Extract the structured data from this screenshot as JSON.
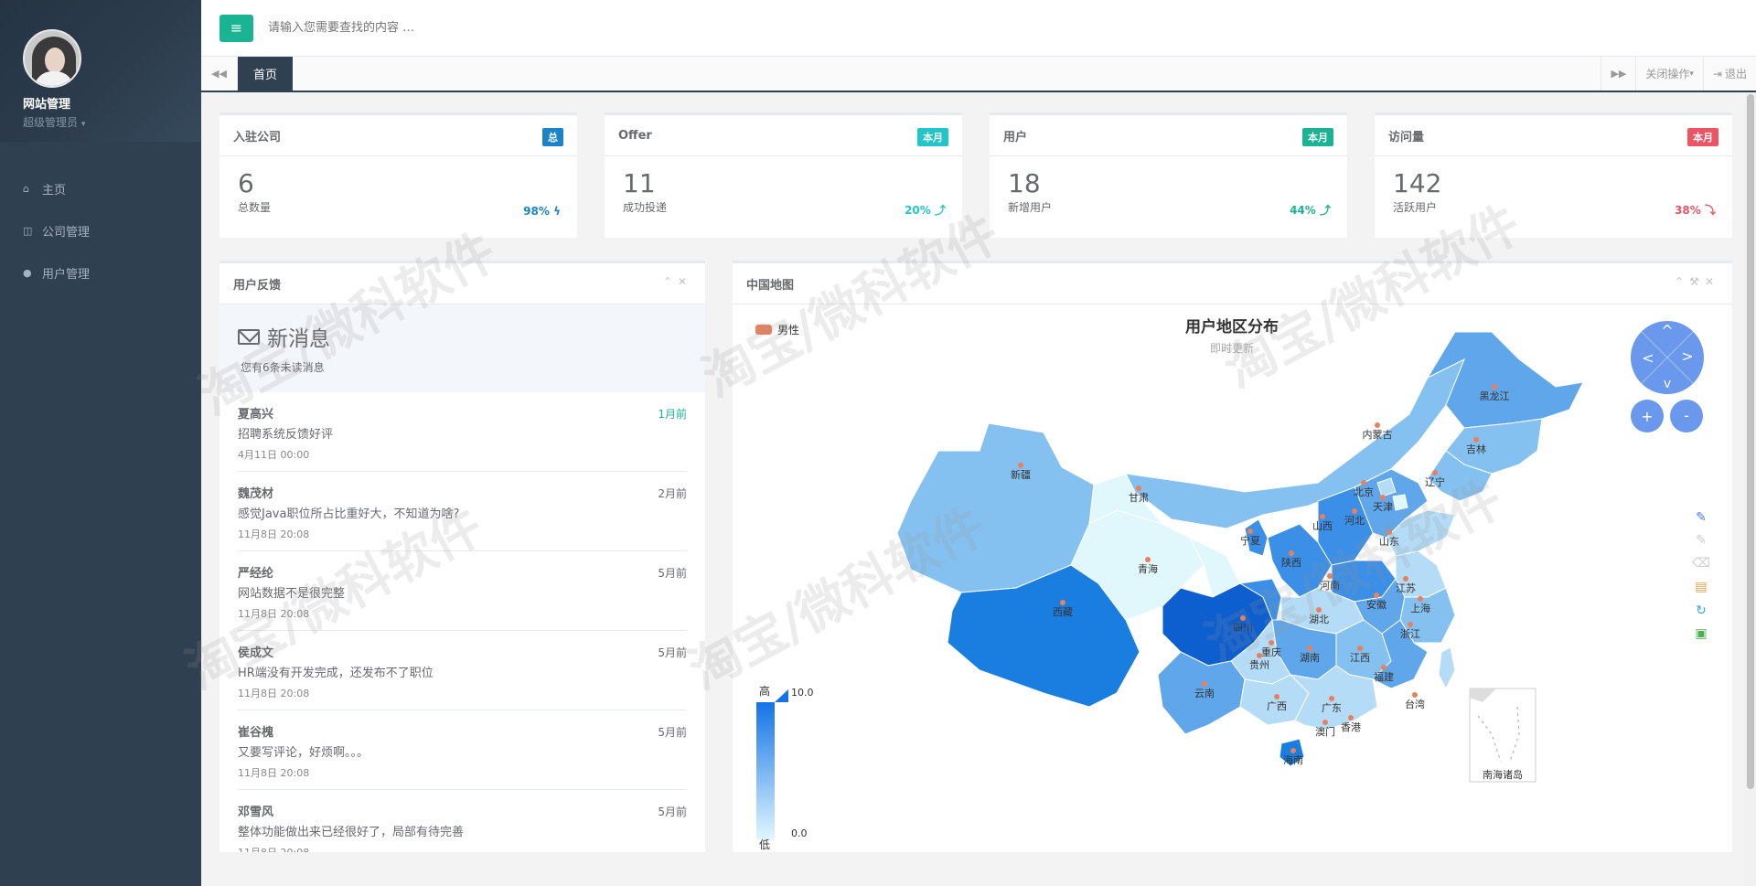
{
  "sidebar": {
    "user_name": "网站管理",
    "user_role": "超级管理员",
    "items": [
      {
        "label": "主页",
        "icon": "home-icon"
      },
      {
        "label": "公司管理",
        "icon": "columns-icon"
      },
      {
        "label": "用户管理",
        "icon": "user-icon"
      }
    ]
  },
  "topbar": {
    "search_placeholder": "请输入您需要查找的内容 …"
  },
  "tabs": {
    "active": "首页",
    "close_ops": "关闭操作",
    "logout": "退出"
  },
  "stats": [
    {
      "title": "入驻公司",
      "badge": "总",
      "badge_color": "#1c84c6",
      "value": "6",
      "label": "总数量",
      "percent": "98%",
      "percent_color": "#1c84c6",
      "trend": "bolt"
    },
    {
      "title": "Offer",
      "badge": "本月",
      "badge_color": "#23c6c8",
      "value": "11",
      "label": "成功投递",
      "percent": "20%",
      "percent_color": "#23c6c8",
      "trend": "up"
    },
    {
      "title": "用户",
      "badge": "本月",
      "badge_color": "#1ab394",
      "value": "18",
      "label": "新增用户",
      "percent": "44%",
      "percent_color": "#1ab394",
      "trend": "up"
    },
    {
      "title": "访问量",
      "badge": "本月",
      "badge_color": "#ed5565",
      "value": "142",
      "label": "活跃用户",
      "percent": "38%",
      "percent_color": "#ed5565",
      "trend": "down"
    }
  ],
  "feedback": {
    "title": "用户反馈",
    "new_title": "新消息",
    "new_sub": "您有6条未读消息",
    "items": [
      {
        "name": "夏高兴",
        "text": "招聘系统反馈好评",
        "date": "4月11日 00:00",
        "time": "1月前",
        "recent": true
      },
      {
        "name": "魏茂材",
        "text": "感觉Java职位所占比重好大，不知道为啥?",
        "date": "11月8日 20:08",
        "time": "2月前",
        "recent": false
      },
      {
        "name": "严经纶",
        "text": "网站数据不是很完整",
        "date": "11月8日 20:08",
        "time": "5月前",
        "recent": false
      },
      {
        "name": "侯成文",
        "text": "HR端没有开发完成，还发布不了职位",
        "date": "11月8日 20:08",
        "time": "5月前",
        "recent": false
      },
      {
        "name": "崔谷槐",
        "text": "又要写评论，好烦啊。。。",
        "date": "11月8日 20:08",
        "time": "5月前",
        "recent": false
      },
      {
        "name": "邓雪风",
        "text": "整体功能做出来已经很好了，局部有待完善",
        "date": "11月8日 20:08",
        "time": "5月前",
        "recent": false
      }
    ]
  },
  "map": {
    "panel_title": "中国地图",
    "title": "用户地区分布",
    "subtitle": "即时更新",
    "legend": "男性",
    "legend_color": "#e8805e",
    "range_high_label": "高",
    "range_low_label": "低",
    "range_max": "10.0",
    "range_min": "0.0",
    "south_sea_label": "南海诸岛",
    "provinces": [
      "黑龙江",
      "吉林",
      "辽宁",
      "内蒙古",
      "新疆",
      "甘肃",
      "宁夏",
      "北京",
      "天津",
      "河北",
      "山西",
      "山东",
      "陕西",
      "青海",
      "西藏",
      "四川",
      "重庆",
      "河南",
      "湖北",
      "安徽",
      "江苏",
      "上海",
      "浙江",
      "湖南",
      "江西",
      "福建",
      "贵州",
      "云南",
      "广西",
      "广东",
      "台湾",
      "澳门",
      "香港",
      "海南"
    ]
  },
  "watermark": "淘宝/微科软件"
}
